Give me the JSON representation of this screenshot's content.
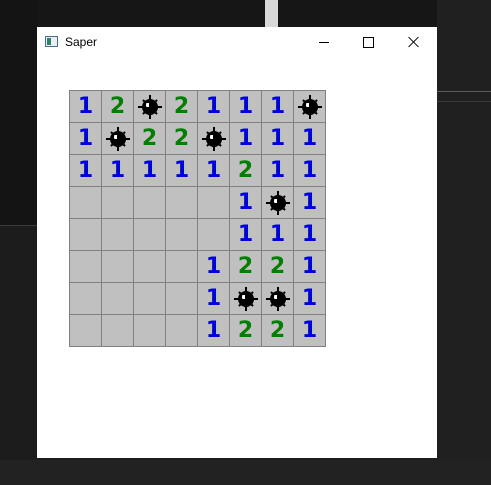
{
  "window": {
    "title": "Saper",
    "icon": "app-window-icon",
    "controls": [
      "minimize",
      "maximize",
      "close"
    ]
  },
  "board": {
    "rows": 8,
    "cols": 8,
    "colors": {
      "one": "#0000d8",
      "two": "#008000",
      "covered": "#c0c0c0",
      "grid": "#808080"
    },
    "cells": [
      [
        "1",
        "2",
        "mine",
        "2",
        "1",
        "1",
        "1",
        "mine"
      ],
      [
        "1",
        "mine",
        "2",
        "2",
        "mine",
        "1",
        "1",
        "1"
      ],
      [
        "1",
        "1",
        "1",
        "1",
        "1",
        "2",
        "1",
        "1"
      ],
      [
        "",
        "",
        "",
        "",
        "",
        "1",
        "mine",
        "1"
      ],
      [
        "",
        "",
        "",
        "",
        "",
        "1",
        "1",
        "1"
      ],
      [
        "",
        "",
        "",
        "",
        "1",
        "2",
        "2",
        "1"
      ],
      [
        "",
        "",
        "",
        "",
        "1",
        "mine",
        "mine",
        "1"
      ],
      [
        "",
        "",
        "",
        "",
        "1",
        "2",
        "2",
        "1"
      ]
    ]
  }
}
